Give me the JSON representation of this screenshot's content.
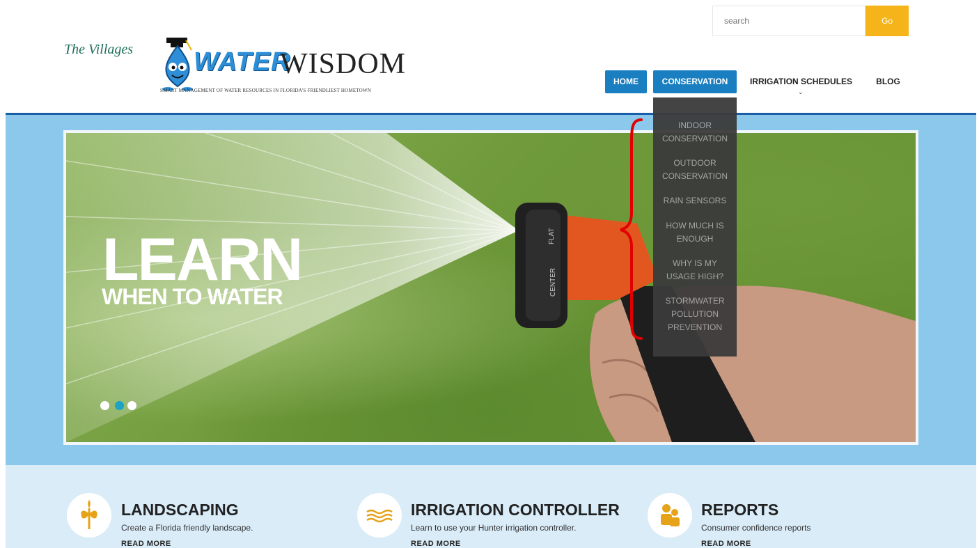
{
  "header": {
    "search_placeholder": "search",
    "go_label": "Go",
    "logo": {
      "villages": "The Villages",
      "water": "WATER",
      "wisdom": "WISDOM",
      "tagline": "SMART MANAGEMENT OF WATER RESOURCES IN FLORIDA'S FRIENDLIEST HOMETOWN"
    }
  },
  "nav": {
    "items": [
      {
        "label": "HOME"
      },
      {
        "label": "CONSERVATION"
      },
      {
        "label": "IRRIGATION SCHEDULES"
      },
      {
        "label": "BLOG"
      }
    ]
  },
  "dropdown": {
    "items": [
      {
        "line1": "INDOOR",
        "line2": "CONSERVATION"
      },
      {
        "line1": "OUTDOOR",
        "line2": "CONSERVATION"
      },
      {
        "line1": "RAIN SENSORS"
      },
      {
        "line1": "HOW MUCH IS",
        "line2": "ENOUGH"
      },
      {
        "line1": "WHY IS MY",
        "line2": "USAGE HIGH?"
      },
      {
        "line1": "STORMWATER",
        "line2": "POLLUTION",
        "line3": "PREVENTION"
      }
    ]
  },
  "hero": {
    "headline": "LEARN",
    "subheadline": "WHEN TO WATER",
    "nozzle_label_center": "CENTER",
    "nozzle_label_flat": "FLAT"
  },
  "features": [
    {
      "title": "LANDSCAPING",
      "desc": "Create a Florida friendly landscape.",
      "more": "READ MORE",
      "icon": "plant-icon"
    },
    {
      "title": "IRRIGATION CONTROLLER",
      "desc": "Learn to use your Hunter irrigation controller.",
      "more": "READ MORE",
      "icon": "water-waves-icon"
    },
    {
      "title": "REPORTS",
      "desc": "Consumer confidence reports",
      "more": "READ MORE",
      "icon": "people-icon"
    }
  ],
  "colors": {
    "nav_active": "#1a7fc0",
    "go_button": "#f4b41a",
    "hero_band": "#8cc8ec",
    "dot_active": "#1ca3c6",
    "annotation": "#e00000"
  }
}
